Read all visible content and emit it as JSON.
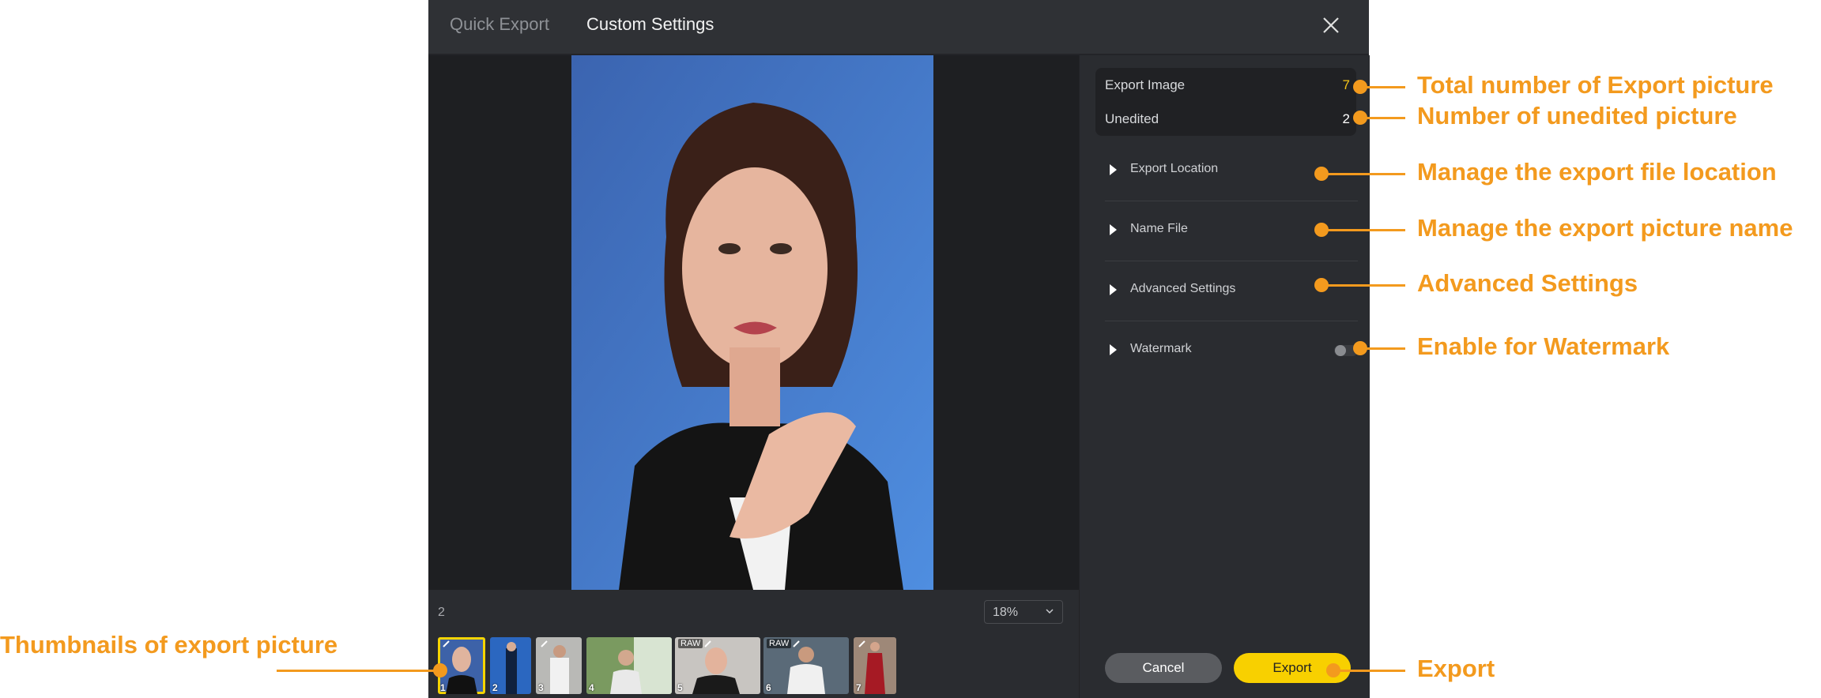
{
  "header": {
    "tab_quick": "Quick Export",
    "tab_custom": "Custom Settings"
  },
  "preview": {
    "count": "2",
    "zoom": "18%"
  },
  "thumbnails": [
    {
      "num": "1",
      "raw": ""
    },
    {
      "num": "2",
      "raw": ""
    },
    {
      "num": "3",
      "raw": ""
    },
    {
      "num": "4",
      "raw": ""
    },
    {
      "num": "5",
      "raw": "RAW"
    },
    {
      "num": "6",
      "raw": "RAW"
    },
    {
      "num": "7",
      "raw": ""
    }
  ],
  "stats": {
    "export_label": "Export Image",
    "export_value": "7",
    "unedited_label": "Unedited",
    "unedited_value": "2"
  },
  "sections": {
    "location": "Export Location",
    "name_file": "Name File",
    "advanced": "Advanced Settings",
    "watermark": "Watermark"
  },
  "buttons": {
    "cancel": "Cancel",
    "export": "Export"
  },
  "annotations": {
    "total": "Total number of Export picture",
    "unedited": "Number of unedited picture",
    "location": "Manage the export file location",
    "name": "Manage the export picture name",
    "advanced": "Advanced Settings",
    "watermark": "Enable for Watermark",
    "export": "Export",
    "thumbnails": "Thumbnails of export picture"
  },
  "colors": {
    "accent": "#f8d000",
    "annotation": "#f39a1e",
    "export_count": "#f5c518"
  }
}
